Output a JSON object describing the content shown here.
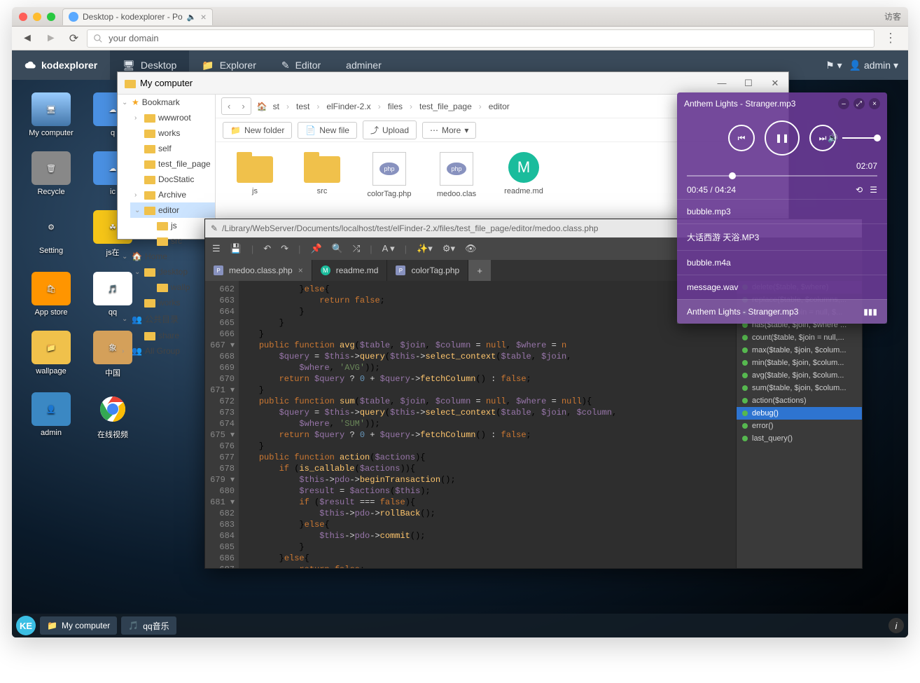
{
  "browser": {
    "tab_title": "Desktop - kodexplorer - Po",
    "guest": "访客",
    "address": "your domain"
  },
  "topnav": {
    "brand": "kodexplorer",
    "items": [
      "Desktop",
      "Explorer",
      "Editor",
      "adminer"
    ],
    "user": "admin"
  },
  "desktop": [
    {
      "label": "My computer"
    },
    {
      "label": "q"
    },
    {
      "label": "Recycle"
    },
    {
      "label": "ic"
    },
    {
      "label": "Setting"
    },
    {
      "label": "js在"
    },
    {
      "label": "App store"
    },
    {
      "label": "qq"
    },
    {
      "label": "wallpage"
    },
    {
      "label": "中国"
    },
    {
      "label": "admin"
    },
    {
      "label": "在线视频"
    }
  ],
  "taskbar": {
    "items": [
      "My computer",
      "qq音乐"
    ]
  },
  "explorer": {
    "title": "My computer",
    "tree": {
      "bookmark": "Bookmark",
      "bookmark_items": [
        "wwwroot",
        "works",
        "self",
        "test_file_page",
        "DocStatic",
        "Archive",
        "editor"
      ],
      "editor_items": [
        "js",
        "src"
      ],
      "home": "Home",
      "home_items": [
        "desktop",
        "wallp",
        "works"
      ],
      "public": "公共目录",
      "public_items": [
        "share"
      ],
      "allgroup": "All Group"
    },
    "breadcrumbs": [
      "st",
      "test",
      "elFinder-2.x",
      "files",
      "test_file_page",
      "editor"
    ],
    "tools": {
      "new_folder": "New folder",
      "new_file": "New file",
      "upload": "Upload",
      "more": "More"
    },
    "files": [
      "js",
      "src",
      "colorTag.php",
      "medoo.clas",
      "readme.md"
    ]
  },
  "editor": {
    "path": "/Library/WebServer/Documents/localhost/test/elFinder-2.x/files/test_file_page/editor/medoo.class.php",
    "tabs": [
      "medoo.class.php",
      "readme.md",
      "colorTag.php"
    ],
    "lines_start": 662,
    "lines_end": 687,
    "fnlist": [
      "delete($table, $where)",
      "replace($table, $columns,...",
      "get($table, $join = null, $...",
      "has($table, $join, $where ...",
      "count($table, $join = null,...",
      "max($table, $join, $colum...",
      "min($table, $join, $colum...",
      "avg($table, $join, $colum...",
      "sum($table, $join, $colum...",
      "action($actions)",
      "debug()",
      "error()",
      "last_query()"
    ],
    "fn_selected": "debug()"
  },
  "player": {
    "title": "Anthem Lights - Stranger.mp3",
    "badge_time": "02:07",
    "elapsed": "00:45",
    "total": "04:24",
    "tracks": [
      "bubble.mp3",
      "大话西游 天浴.MP3",
      "bubble.m4a",
      "message.wav",
      "Anthem Lights - Stranger.mp3"
    ],
    "active_track": 4
  }
}
